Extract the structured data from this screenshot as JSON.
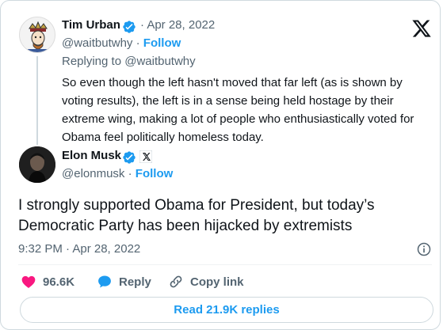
{
  "quoted_tweet": {
    "name": "Tim Urban",
    "date": "· Apr 28, 2022",
    "handle": "@waitbutwhy",
    "follow_label": "Follow",
    "replying_to": "Replying to @waitbutwhy",
    "text": "So even though the left hasn't moved that far left (as is shown by voting results), the left is in a sense being held hostage by their extreme wing, making a lot of people who enthusiastically voted for Obama feel politically homeless today."
  },
  "main_tweet": {
    "name": "Elon Musk",
    "handle": "@elonmusk",
    "follow_label": "Follow",
    "text": "I strongly supported Obama for President, but today’s Democratic Party has been hijacked by extremists",
    "timestamp": "9:32 PM · Apr 28, 2022"
  },
  "actions": {
    "like_count": "96.6K",
    "reply_label": "Reply",
    "copy_link_label": "Copy link"
  },
  "read_replies_label": "Read 21.9K replies",
  "colors": {
    "accent": "#1d9bf0",
    "like": "#f91880",
    "text": "#0f1419",
    "muted": "#536471",
    "border": "#cfd9de"
  },
  "icons": [
    "verified-badge-icon",
    "x-logo-icon",
    "heart-icon",
    "reply-bubble-icon",
    "link-icon",
    "info-icon"
  ]
}
